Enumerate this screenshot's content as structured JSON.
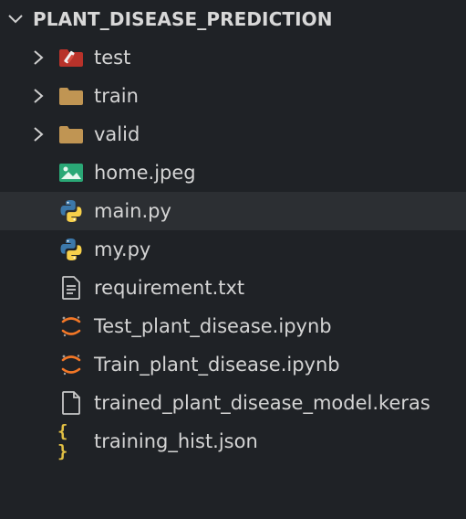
{
  "explorer": {
    "root_title": "PLANT_DISEASE_PREDICTION",
    "root_expanded": true,
    "items": [
      {
        "label": "test",
        "kind": "folder",
        "icon": "test-folder-icon",
        "expandable": true
      },
      {
        "label": "train",
        "kind": "folder",
        "icon": "folder-icon",
        "expandable": true
      },
      {
        "label": "valid",
        "kind": "folder",
        "icon": "folder-icon",
        "expandable": true
      },
      {
        "label": "home.jpeg",
        "kind": "file",
        "icon": "image-file-icon",
        "expandable": false
      },
      {
        "label": "main.py",
        "kind": "file",
        "icon": "python-file-icon",
        "expandable": false,
        "selected": true
      },
      {
        "label": "my.py",
        "kind": "file",
        "icon": "python-file-icon",
        "expandable": false
      },
      {
        "label": "requirement.txt",
        "kind": "file",
        "icon": "text-file-icon",
        "expandable": false
      },
      {
        "label": "Test_plant_disease.ipynb",
        "kind": "file",
        "icon": "jupyter-notebook-icon",
        "expandable": false
      },
      {
        "label": "Train_plant_disease.ipynb",
        "kind": "file",
        "icon": "jupyter-notebook-icon",
        "expandable": false
      },
      {
        "label": "trained_plant_disease_model.keras",
        "kind": "file",
        "icon": "blank-file-icon",
        "expandable": false
      },
      {
        "label": "training_hist.json",
        "kind": "file",
        "icon": "json-file-icon",
        "expandable": false,
        "icon_text": "{ }"
      }
    ]
  },
  "colors": {
    "background": "#1f2226",
    "selected_row": "#2c2f33",
    "text": "#d4d4d4",
    "folder": "#c09553",
    "test_folder": "#c0392b",
    "python_blue": "#3c78aa",
    "python_yellow": "#f7d04b",
    "jupyter_orange": "#f37726",
    "json_yellow": "#e2c044",
    "image_teal": "#2aa876"
  }
}
